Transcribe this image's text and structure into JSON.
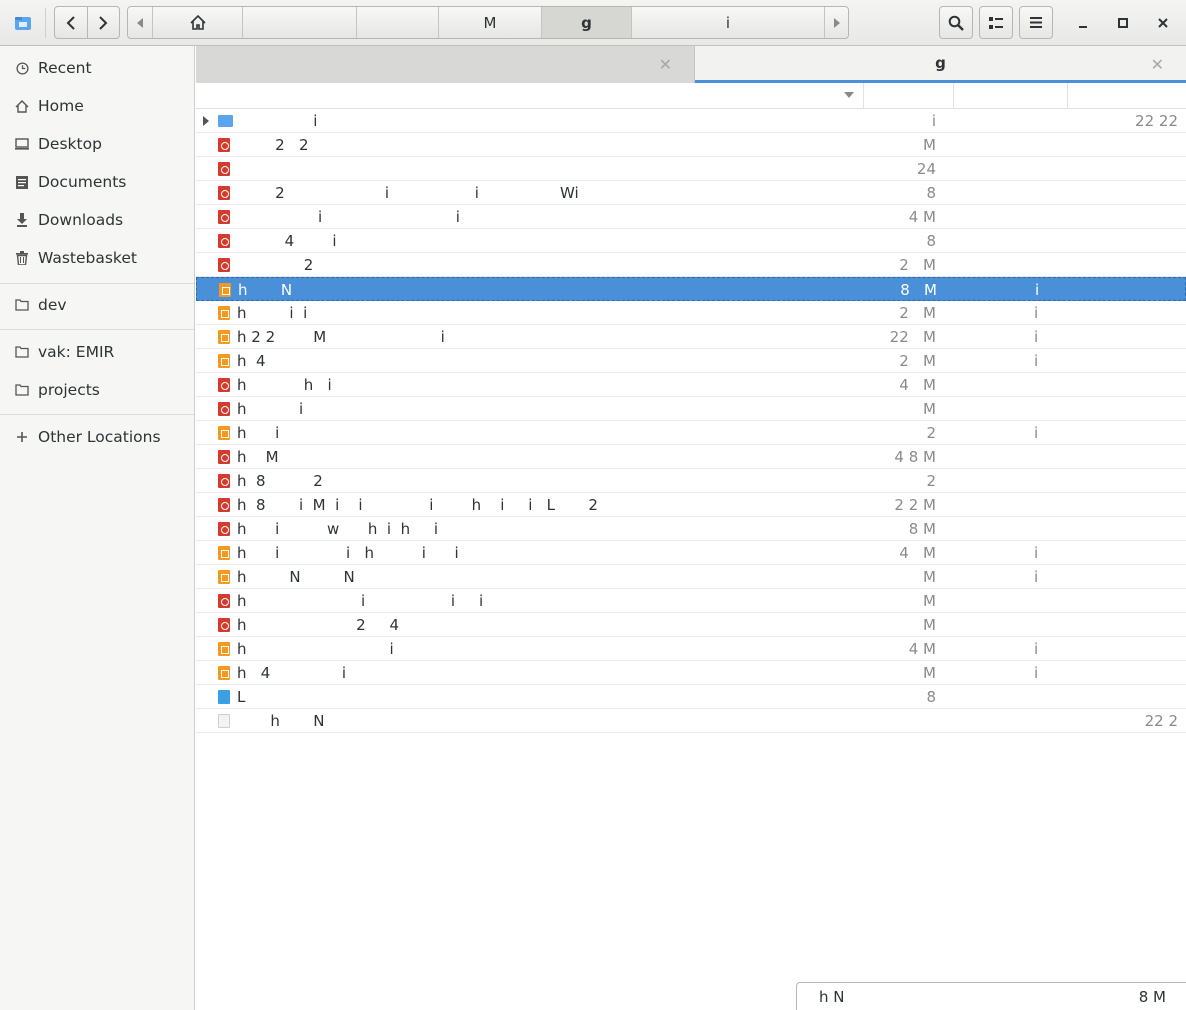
{
  "header": {
    "path_segments": [
      "",
      "",
      "",
      "M",
      "g",
      "i"
    ],
    "active_segment": 4
  },
  "sidebar": {
    "items": [
      {
        "label": "Recent",
        "icon": "clock-icon"
      },
      {
        "label": "Home",
        "icon": "home-icon"
      },
      {
        "label": "Desktop",
        "icon": "desktop-icon"
      },
      {
        "label": "Documents",
        "icon": "documents-icon"
      },
      {
        "label": "Downloads",
        "icon": "download-icon"
      },
      {
        "label": "Wastebasket",
        "icon": "trash-icon"
      },
      {
        "label": "dev",
        "icon": "folder-icon"
      },
      {
        "label": "vak: EMIR",
        "icon": "folder-icon"
      },
      {
        "label": "projects",
        "icon": "folder-icon"
      },
      {
        "label": "Other Locations",
        "icon": "plus-icon"
      }
    ]
  },
  "tabs": [
    {
      "label": ""
    },
    {
      "label": "g"
    }
  ],
  "files": [
    {
      "name": "                i",
      "size": "i",
      "type": "",
      "date": "22 22",
      "kind": "folder"
    },
    {
      "name": "        2   2",
      "size": "M",
      "type": "",
      "date": "",
      "kind": "pdf"
    },
    {
      "name": "",
      "size": "24",
      "type": "",
      "date": "",
      "kind": "pdf"
    },
    {
      "name": "        2                     i                  i                 Wi",
      "size": "8",
      "type": "",
      "date": "",
      "kind": "pdf"
    },
    {
      "name": "                 i                            i",
      "size": "4 M",
      "type": "",
      "date": "",
      "kind": "pdf"
    },
    {
      "name": "          4        i",
      "size": "8",
      "type": "",
      "date": "",
      "kind": "pdf"
    },
    {
      "name": "              2",
      "size": "2   M",
      "type": "",
      "date": "",
      "kind": "pdf"
    },
    {
      "name": "h       N",
      "size": "8   M",
      "type": "i",
      "date": "",
      "kind": "doc"
    },
    {
      "name": "h         i  i",
      "size": "2   M",
      "type": "i",
      "date": "",
      "kind": "doc"
    },
    {
      "name": "h 2 2        M                        i",
      "size": "22   M",
      "type": "i",
      "date": "",
      "kind": "doc"
    },
    {
      "name": "h  4",
      "size": "2   M",
      "type": "i",
      "date": "",
      "kind": "doc"
    },
    {
      "name": "h            h   i",
      "size": "4   M",
      "type": "",
      "date": "",
      "kind": "pdf"
    },
    {
      "name": "h           i",
      "size": "M",
      "type": "",
      "date": "",
      "kind": "pdf"
    },
    {
      "name": "h      i",
      "size": "2",
      "type": "i",
      "date": "",
      "kind": "doc"
    },
    {
      "name": "h    M",
      "size": "4 8 M",
      "type": "",
      "date": "",
      "kind": "pdf"
    },
    {
      "name": "h  8          2",
      "size": "2",
      "type": "",
      "date": "",
      "kind": "pdf"
    },
    {
      "name": "h  8       i  M  i    i              i        h    i     i   L       2",
      "size": "2 2 M",
      "type": "",
      "date": "",
      "kind": "pdf"
    },
    {
      "name": "h      i          w      h  i  h     i",
      "size": "8 M",
      "type": "",
      "date": "",
      "kind": "pdf"
    },
    {
      "name": "h      i              i   h          i      i",
      "size": "4   M",
      "type": "i",
      "date": "",
      "kind": "doc"
    },
    {
      "name": "h         N         N",
      "size": "M",
      "type": "i",
      "date": "",
      "kind": "doc"
    },
    {
      "name": "h                        i                  i     i",
      "size": "M",
      "type": "",
      "date": "",
      "kind": "pdf"
    },
    {
      "name": "h                       2     4",
      "size": "M",
      "type": "",
      "date": "",
      "kind": "pdf"
    },
    {
      "name": "h                              i",
      "size": "4 M",
      "type": "i",
      "date": "",
      "kind": "doc"
    },
    {
      "name": "h   4               i",
      "size": "M",
      "type": "i",
      "date": "",
      "kind": "doc"
    },
    {
      "name": "L",
      "size": "8",
      "type": "",
      "date": "",
      "kind": "blue"
    },
    {
      "name": "       h       N",
      "size": "",
      "type": "",
      "date": "22 2",
      "kind": "blank"
    }
  ],
  "selected_index": 7,
  "status": {
    "name": "h       N",
    "size": "8   M"
  },
  "colors": {
    "accent": "#4a90d9",
    "pdf": "#d63a2f",
    "doc": "#f39a1e"
  }
}
